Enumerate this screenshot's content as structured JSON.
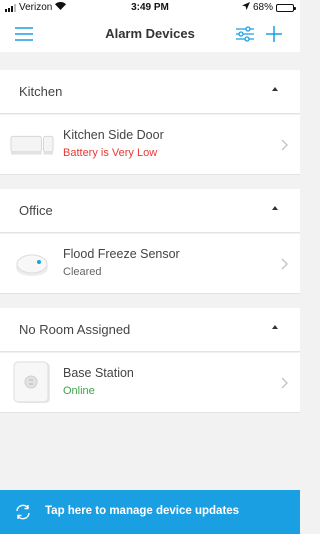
{
  "status_bar": {
    "carrier": "Verizon",
    "time": "3:49 PM",
    "battery": "68%",
    "battery_level": 0.68
  },
  "nav": {
    "title": "Alarm Devices",
    "menu_icon": "hamburger-menu-icon",
    "filter_icon": "sliders-icon",
    "add_icon": "plus-icon"
  },
  "rooms": [
    {
      "name": "Kitchen",
      "devices": [
        {
          "name": "Kitchen Side Door",
          "status": "Battery is Very Low",
          "status_color": "#e53935",
          "icon": "contact-sensor-icon"
        }
      ]
    },
    {
      "name": "Office",
      "devices": [
        {
          "name": "Flood Freeze Sensor",
          "status": "Cleared",
          "status_color": "#666666",
          "icon": "flood-freeze-sensor-icon"
        }
      ]
    },
    {
      "name": "No Room Assigned",
      "devices": [
        {
          "name": "Base Station",
          "status": "Online",
          "status_color": "#3ea54a",
          "icon": "base-station-icon"
        }
      ]
    }
  ],
  "banner": {
    "text": "Tap here to manage device updates",
    "icon": "refresh-icon",
    "color": "#1b9fe3"
  }
}
